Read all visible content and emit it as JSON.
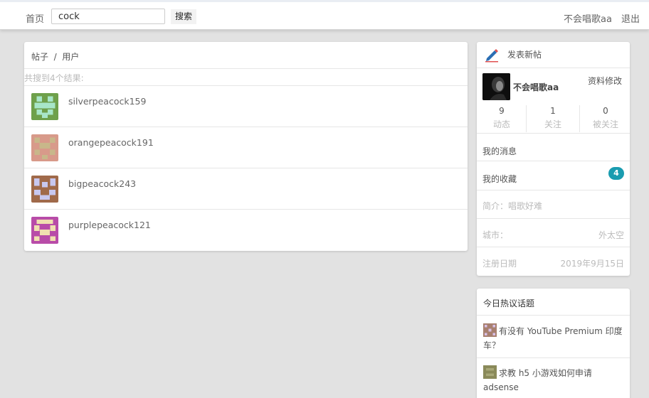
{
  "nav": {
    "home": "首页",
    "search_value": "cock",
    "search_button": "搜索",
    "username": "不会唱歌aa",
    "logout": "退出"
  },
  "results": {
    "breadcrumb": "帖子  /  用户",
    "count_text": "共搜到4个结果:",
    "users": [
      {
        "name": "silverpeacock159",
        "avatar_color": "#6ea04b",
        "avatar_bg": "#a8e6c8"
      },
      {
        "name": "orangepeacock191",
        "avatar_color": "#d89a8a",
        "avatar_bg": "#c8b78a"
      },
      {
        "name": "bigpeacock243",
        "avatar_color": "#a06a4a",
        "avatar_bg": "#c8c8f0"
      },
      {
        "name": "purplepeacock121",
        "avatar_color": "#b84ca8",
        "avatar_bg": "#f0e0b0"
      }
    ]
  },
  "profile": {
    "new_post": "发表新帖",
    "name": "不会唱歌aa",
    "edit": "资料修改",
    "stats": [
      {
        "value": "9",
        "label": "动态"
      },
      {
        "value": "1",
        "label": "关注"
      },
      {
        "value": "0",
        "label": "被关注"
      }
    ],
    "messages": "我的消息",
    "favorites": "我的收藏",
    "favorites_badge": "4",
    "bio": "简介：唱歌好难",
    "city_label": "城市：",
    "city_value": "外太空",
    "reg_label": "注册日期",
    "reg_value": "2019年9月15日"
  },
  "hot_topics": {
    "title": "今日热议话题",
    "items": [
      {
        "text": "有没有 YouTube Premium 印度车？"
      },
      {
        "text": "求教 h5 小游戏如何申请 adsense"
      }
    ]
  },
  "colors": {
    "badge": "#1a9cb0",
    "page_bg": "#e2e2e2",
    "edit_pencil": "#2b6fb4"
  }
}
